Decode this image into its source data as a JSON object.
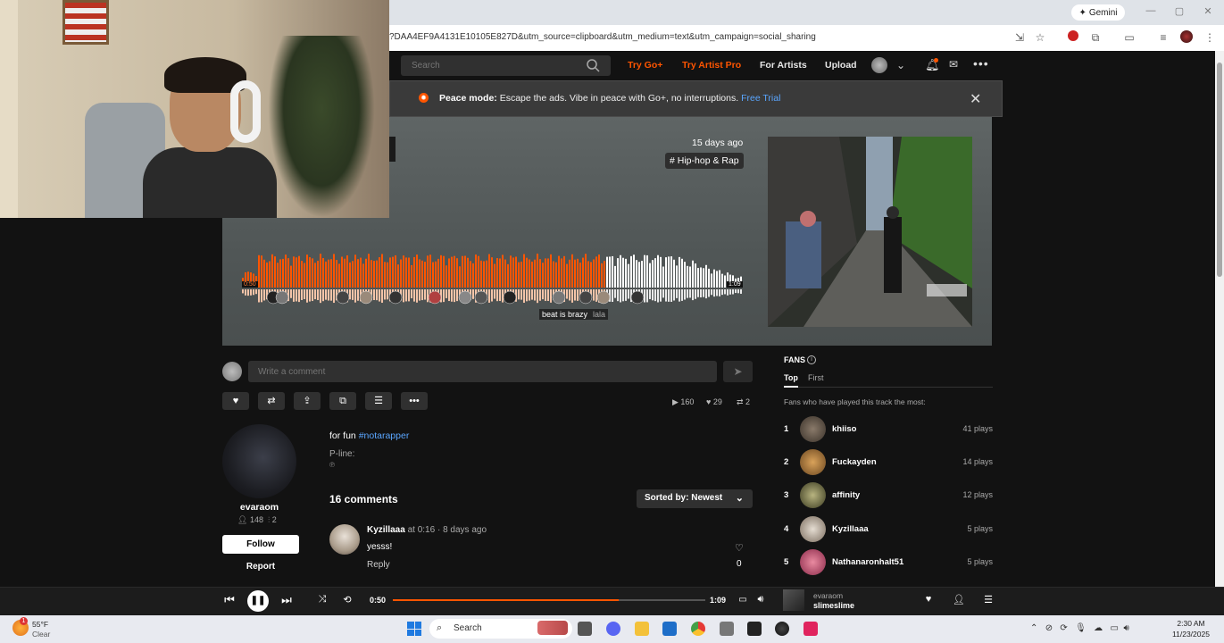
{
  "browser": {
    "url": "?DAA4EF9A4131E10105E827D&utm_source=clipboard&utm_medium=text&utm_campaign=social_sharing",
    "gemini_label": "Gemini"
  },
  "site_header": {
    "search_placeholder": "Search",
    "try_go": "Try Go+",
    "try_artist_pro": "Try Artist Pro",
    "for_artists": "For Artists",
    "upload": "Upload"
  },
  "banner": {
    "title": "Peace mode:",
    "text": " Escape the ads. Vibe in peace with Go+, no interruptions. ",
    "link": "Free Trial"
  },
  "track": {
    "posted": "15 days ago",
    "tag": "# Hip-hop & Rap",
    "time_left": "0:50",
    "time_right": "1:09",
    "played_fraction": 0.724,
    "wave_comment": "beat is brazy",
    "wave_comment_user": "lala"
  },
  "comment_box": {
    "placeholder": "Write a comment"
  },
  "stats": {
    "plays": "160",
    "likes": "29",
    "reposts": "2"
  },
  "uploader": {
    "name": "evaraom",
    "followers": "148",
    "tracks": "2",
    "follow_label": "Follow",
    "report_label": "Report"
  },
  "description": {
    "text": "for fun ",
    "hashtag": "#notarapper",
    "pline_label": "P-line:",
    "pline_symbol": "℗"
  },
  "comments": {
    "count_label": "16 comments",
    "sort_label": "Sorted by: Newest",
    "items": [
      {
        "user": "Kyzillaaa",
        "at": " at ",
        "timestamp": "0:16",
        "age": " · 8 days ago",
        "text": "yesss!",
        "reply": "Reply",
        "likes": "0"
      }
    ]
  },
  "fans": {
    "title": "FANS",
    "tab_top": "Top",
    "tab_first": "First",
    "description": "Fans who have played this track the most:",
    "items": [
      {
        "rank": "1",
        "name": "khiiso",
        "plays": "41 plays"
      },
      {
        "rank": "2",
        "name": "Fuckayden",
        "plays": "14 plays"
      },
      {
        "rank": "3",
        "name": "affinity",
        "plays": "12 plays"
      },
      {
        "rank": "4",
        "name": "Kyzillaaa",
        "plays": "5 plays"
      },
      {
        "rank": "5",
        "name": "Nathanaronhalt51",
        "plays": "5 plays"
      }
    ]
  },
  "player": {
    "current": "0:50",
    "duration": "1:09",
    "progress_fraction": 0.724,
    "artist": "evaraom",
    "title": "slimeslime"
  },
  "taskbar": {
    "temperature": "55°F",
    "condition": "Clear",
    "weather_badge": "1",
    "search_label": "Search",
    "time": "2:30 AM",
    "date": "11/23/2025"
  },
  "colors": {
    "accent": "#ff5500",
    "link": "#5aa6ff"
  }
}
